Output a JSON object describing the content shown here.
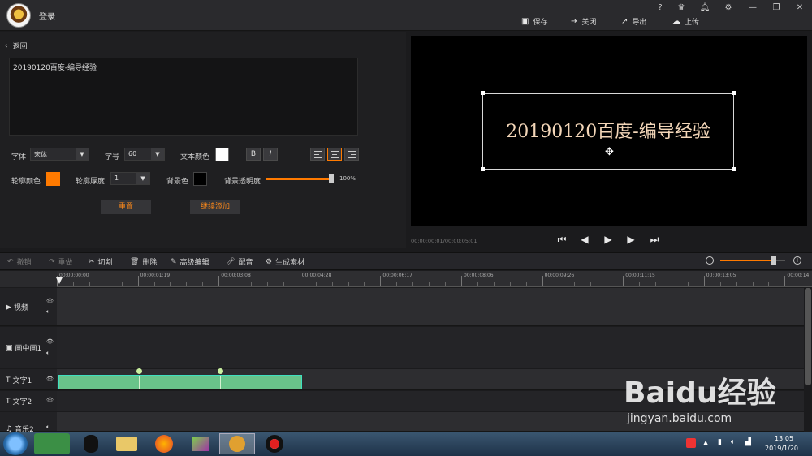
{
  "window": {
    "login": "登录"
  },
  "header": {
    "buttons": [
      {
        "label": "保存",
        "icon": "save-icon"
      },
      {
        "label": "关闭",
        "icon": "close-icon"
      },
      {
        "label": "导出",
        "icon": "export-icon"
      },
      {
        "label": "上传",
        "icon": "upload-icon"
      }
    ],
    "window_controls": [
      "help-icon",
      "vip-icon",
      "notification-icon",
      "settings-icon",
      "minimize-icon",
      "restore-icon",
      "close-window-icon"
    ]
  },
  "editor": {
    "back_label": "返回",
    "text_value": "20190120百度-编导经验",
    "font_label": "字体",
    "font_value": "宋体",
    "size_label": "字号",
    "size_value": "60",
    "text_color_label": "文本颜色",
    "text_color": "#ffffff",
    "bold_label": "B",
    "italic_label": "I",
    "outline_color_label": "轮廓颜色",
    "outline_color": "#ff7a00",
    "outline_thickness_label": "轮廓厚度",
    "outline_thickness_value": "1",
    "bg_color_label": "背景色",
    "bg_color": "#000000",
    "bg_opacity_label": "背景透明度",
    "bg_opacity_value": "100%",
    "bg_opacity_fraction": 1.0,
    "reset_label": "重置",
    "continue_add_label": "继续添加"
  },
  "preview": {
    "title_text": "20190120百度-编导经验",
    "timecode": "00:00:00:01/00:00:05:01"
  },
  "toolbar": {
    "undo": "撤销",
    "redo": "重做",
    "cut": "切割",
    "delete": "删除",
    "advanced_edit": "高级编辑",
    "dub": "配音",
    "generate": "生成素材",
    "zoom_fraction": 0.82
  },
  "timeline": {
    "ticks": [
      "00:00:00:00",
      "00:00:01:19",
      "00:00:03:08",
      "00:00:04:28",
      "00:00:06:17",
      "00:00:08:06",
      "00:00:09:26",
      "00:00:11:15",
      "00:00:13:05",
      "00:00:14"
    ],
    "tracks": [
      {
        "name": "视频",
        "icon": "video-icon"
      },
      {
        "name": "画中画1",
        "icon": "pip-icon"
      },
      {
        "name": "文字1",
        "icon": "text-icon"
      },
      {
        "name": "文字2",
        "icon": "text-icon"
      },
      {
        "name": "音乐2",
        "icon": "music-icon"
      }
    ]
  },
  "taskbar": {
    "time": "13:05",
    "date": "2019/1/20"
  },
  "watermark": {
    "brand": "Baidu经验",
    "url": "jingyan.baidu.com"
  }
}
